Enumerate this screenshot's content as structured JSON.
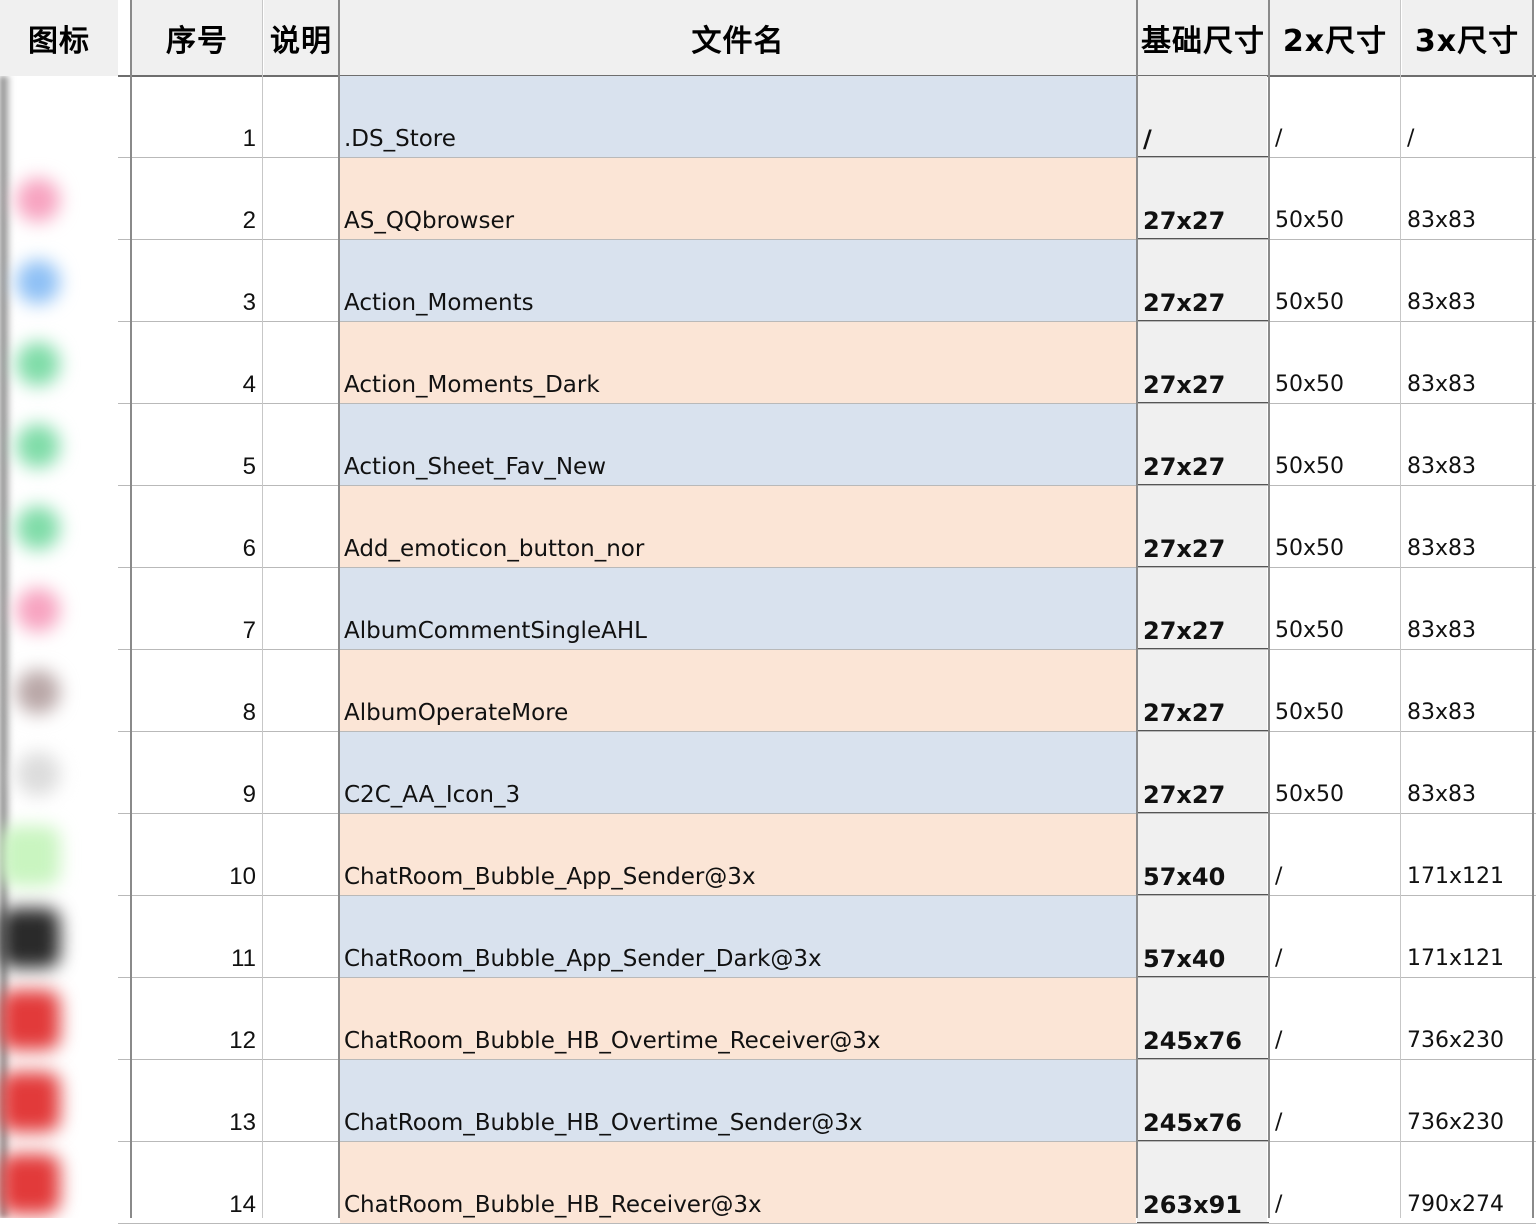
{
  "headers": {
    "icon": "图标",
    "num": "序号",
    "desc": "说明",
    "file": "文件名",
    "base": "基础尺寸",
    "x2": "2x尺寸",
    "x3": "3x尺寸"
  },
  "colors": {
    "row_blue": "#d9e2ee",
    "row_peach": "#fbe5d6",
    "header_bg": "#f0f0f0",
    "base_col_bg": "#f0f0f0"
  },
  "rows": [
    {
      "num": "1",
      "desc": "",
      "file": ".DS_Store",
      "base": "/",
      "x2": "/",
      "x3": "/",
      "fill": "blue",
      "icon_color": "#ffffff"
    },
    {
      "num": "2",
      "desc": "",
      "file": "AS_QQbrowser",
      "base": "27x27",
      "x2": "50x50",
      "x3": "83x83",
      "fill": "peach",
      "icon_color": "#f7a3c0"
    },
    {
      "num": "3",
      "desc": "",
      "file": "Action_Moments",
      "base": "27x27",
      "x2": "50x50",
      "x3": "83x83",
      "fill": "blue",
      "icon_color": "#8ec0f5"
    },
    {
      "num": "4",
      "desc": "",
      "file": "Action_Moments_Dark",
      "base": "27x27",
      "x2": "50x50",
      "x3": "83x83",
      "fill": "peach",
      "icon_color": "#7fdca8"
    },
    {
      "num": "5",
      "desc": "",
      "file": "Action_Sheet_Fav_New",
      "base": "27x27",
      "x2": "50x50",
      "x3": "83x83",
      "fill": "blue",
      "icon_color": "#7fdca8"
    },
    {
      "num": "6",
      "desc": "",
      "file": "Add_emoticon_button_nor",
      "base": "27x27",
      "x2": "50x50",
      "x3": "83x83",
      "fill": "peach",
      "icon_color": "#7fdca8"
    },
    {
      "num": "7",
      "desc": "",
      "file": "AlbumCommentSingleAHL",
      "base": "27x27",
      "x2": "50x50",
      "x3": "83x83",
      "fill": "blue",
      "icon_color": "#f7a3c0"
    },
    {
      "num": "8",
      "desc": "",
      "file": "AlbumOperateMore",
      "base": "27x27",
      "x2": "50x50",
      "x3": "83x83",
      "fill": "peach",
      "icon_color": "#b9a7a7"
    },
    {
      "num": "9",
      "desc": "",
      "file": "C2C_AA_Icon_3",
      "base": "27x27",
      "x2": "50x50",
      "x3": "83x83",
      "fill": "blue",
      "icon_color": "#dcdcdc"
    },
    {
      "num": "10",
      "desc": "",
      "file": "ChatRoom_Bubble_App_Sender@3x",
      "base": "57x40",
      "x2": "/",
      "x3": "171x121",
      "fill": "peach",
      "icon_color": "#c9f5c0"
    },
    {
      "num": "11",
      "desc": "",
      "file": "ChatRoom_Bubble_App_Sender_Dark@3x",
      "base": "57x40",
      "x2": "/",
      "x3": "171x121",
      "fill": "blue",
      "icon_color": "#2a2a2a"
    },
    {
      "num": "12",
      "desc": "",
      "file": "ChatRoom_Bubble_HB_Overtime_Receiver@3x",
      "base": "245x76",
      "x2": "/",
      "x3": "736x230",
      "fill": "peach",
      "icon_color": "#e23a3a"
    },
    {
      "num": "13",
      "desc": "",
      "file": "ChatRoom_Bubble_HB_Overtime_Sender@3x",
      "base": "245x76",
      "x2": "/",
      "x3": "736x230",
      "fill": "blue",
      "icon_color": "#e23a3a"
    },
    {
      "num": "14",
      "desc": "",
      "file": "ChatRoom_Bubble_HB_Receiver@3x",
      "base": "263x91",
      "x2": "/",
      "x3": "790x274",
      "fill": "peach",
      "icon_color": "#e23a3a"
    }
  ]
}
